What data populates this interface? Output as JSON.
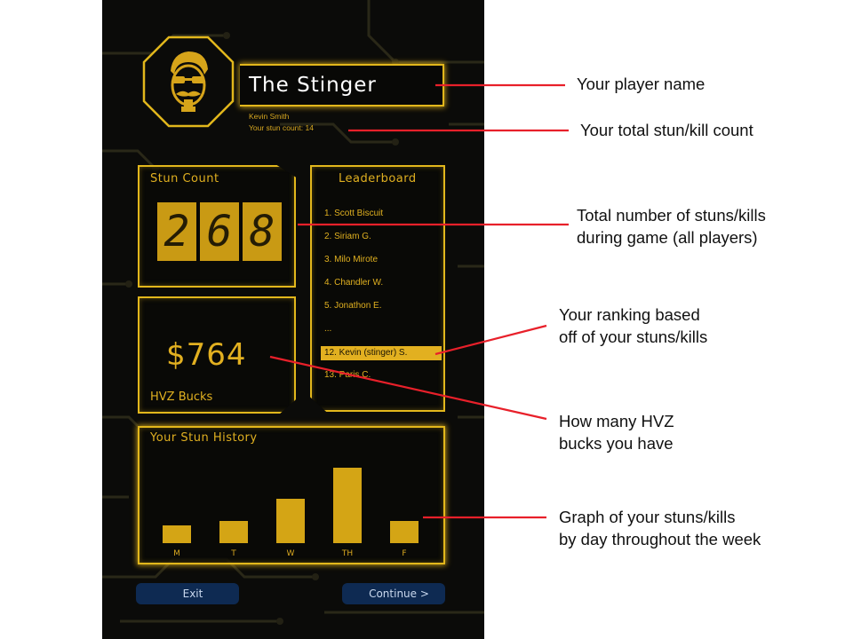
{
  "profile": {
    "player_name": "The Stinger",
    "real_name": "Kevin Smith",
    "stun_count_line": "Your stun count: 14"
  },
  "stun_panel": {
    "title": "Stun Count",
    "digits": [
      "2",
      "6",
      "8"
    ]
  },
  "bucks_panel": {
    "value": "$764",
    "label": "HVZ Bucks"
  },
  "leaderboard": {
    "title": "Leaderboard",
    "entries": [
      "1.  Scott Biscuit",
      "2. Siriam G.",
      "3. Milo Mirote",
      "4.  Chandler W.",
      "5.  Jonathon E.",
      "...",
      "12. Kevin (stinger) S.",
      "13. Paris C."
    ],
    "highlight_index": 6
  },
  "history": {
    "title": "Your Stun History"
  },
  "chart_data": {
    "type": "bar",
    "title": "Your Stun History",
    "categories": [
      "M",
      "T",
      "W",
      "TH",
      "F"
    ],
    "values": [
      2,
      2.5,
      5,
      8.5,
      2.5
    ],
    "ylim": [
      0,
      10
    ],
    "bar_color": "#d4a515"
  },
  "buttons": {
    "exit": "Exit",
    "continue": "Continue >"
  },
  "annotations": {
    "player_name": "Your player name",
    "stun_total": "Your total stun/kill count",
    "total_game_line1": "Total number of stuns/kills",
    "total_game_line2": "during game (all players)",
    "ranking_line1": "Your ranking based",
    "ranking_line2": "off of your stuns/kills",
    "bucks_line1": "How many HVZ",
    "bucks_line2": "bucks you have",
    "graph_line1": "Graph of your stuns/kills",
    "graph_line2": "by day throughout the week"
  },
  "colors": {
    "accent": "#e2b71c",
    "background": "#0b0b09",
    "button": "#0e2a52",
    "annotation_line": "#e8202a"
  },
  "icons": {
    "avatar": "mustache-sunglasses-avatar-icon"
  }
}
